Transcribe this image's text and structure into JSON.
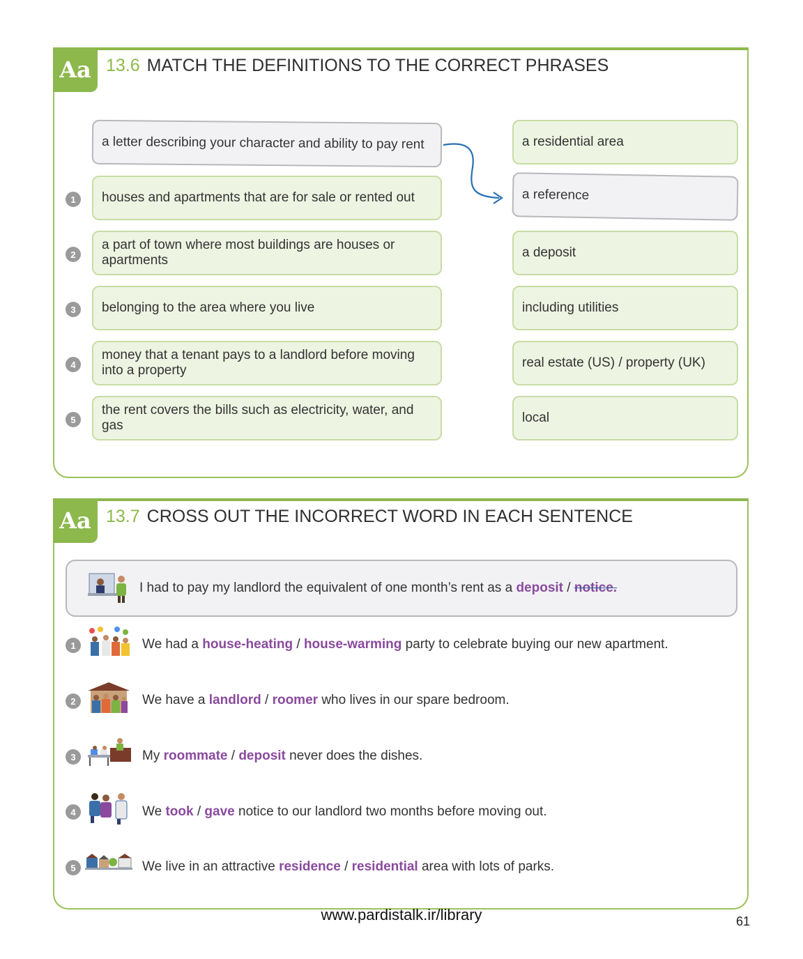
{
  "ex1": {
    "badge": "Aa",
    "number": "13.6",
    "title": "MATCH THE DEFINITIONS TO THE CORRECT PHRASES",
    "example_definition": "a letter describing your character and ability to pay rent",
    "example_answer": "a reference",
    "items": [
      {
        "num": "1",
        "definition": "houses and apartments that are for sale or rented out"
      },
      {
        "num": "2",
        "definition": "a part of town where most buildings are houses or apartments"
      },
      {
        "num": "3",
        "definition": "belonging to the area where you live"
      },
      {
        "num": "4",
        "definition": "money that a tenant pays to a landlord before moving into a property"
      },
      {
        "num": "5",
        "definition": "the rent covers the bills such as electricity, water, and gas"
      }
    ],
    "phrases": [
      "a residential area",
      "a deposit",
      "including utilities",
      "real estate (US) / property (UK)",
      "local"
    ]
  },
  "ex2": {
    "badge": "Aa",
    "number": "13.7",
    "title": "CROSS OUT THE INCORRECT WORD IN EACH SENTENCE",
    "example": {
      "before": "I had to pay my landlord the equivalent of one month’s rent as a",
      "opt1": "deposit",
      "sep": "/",
      "opt2": "notice.",
      "after": ""
    },
    "items": [
      {
        "num": "1",
        "before": "We had a",
        "opt1": "house-heating",
        "sep": "/",
        "opt2": "house-warming",
        "after": "party to celebrate buying our new apartment.",
        "icon": "party-icon"
      },
      {
        "num": "2",
        "before": "We have a",
        "opt1": "landlord",
        "sep": "/",
        "opt2": "roomer",
        "after": "who lives in our spare bedroom.",
        "icon": "family-house-icon"
      },
      {
        "num": "3",
        "before": "My",
        "opt1": "roommate",
        "sep": "/",
        "opt2": "deposit",
        "after": "never does the dishes.",
        "icon": "roommates-kitchen-icon"
      },
      {
        "num": "4",
        "before": "We",
        "opt1": "took",
        "sep": "/",
        "opt2": "gave",
        "after": "notice to our landlord two months before moving out.",
        "icon": "people-talking-icon"
      },
      {
        "num": "5",
        "before": "We live in an attractive",
        "opt1": "residence",
        "sep": "/",
        "opt2": "residential",
        "after": "area with lots of parks.",
        "icon": "street-houses-icon"
      }
    ]
  },
  "colors": {
    "accent_green": "#8cb84c",
    "option_purple": "#8a4a9e",
    "arrow_blue": "#2a6fb5"
  },
  "footer": {
    "url": "www.pardistalk.ir/library",
    "page": "61"
  }
}
